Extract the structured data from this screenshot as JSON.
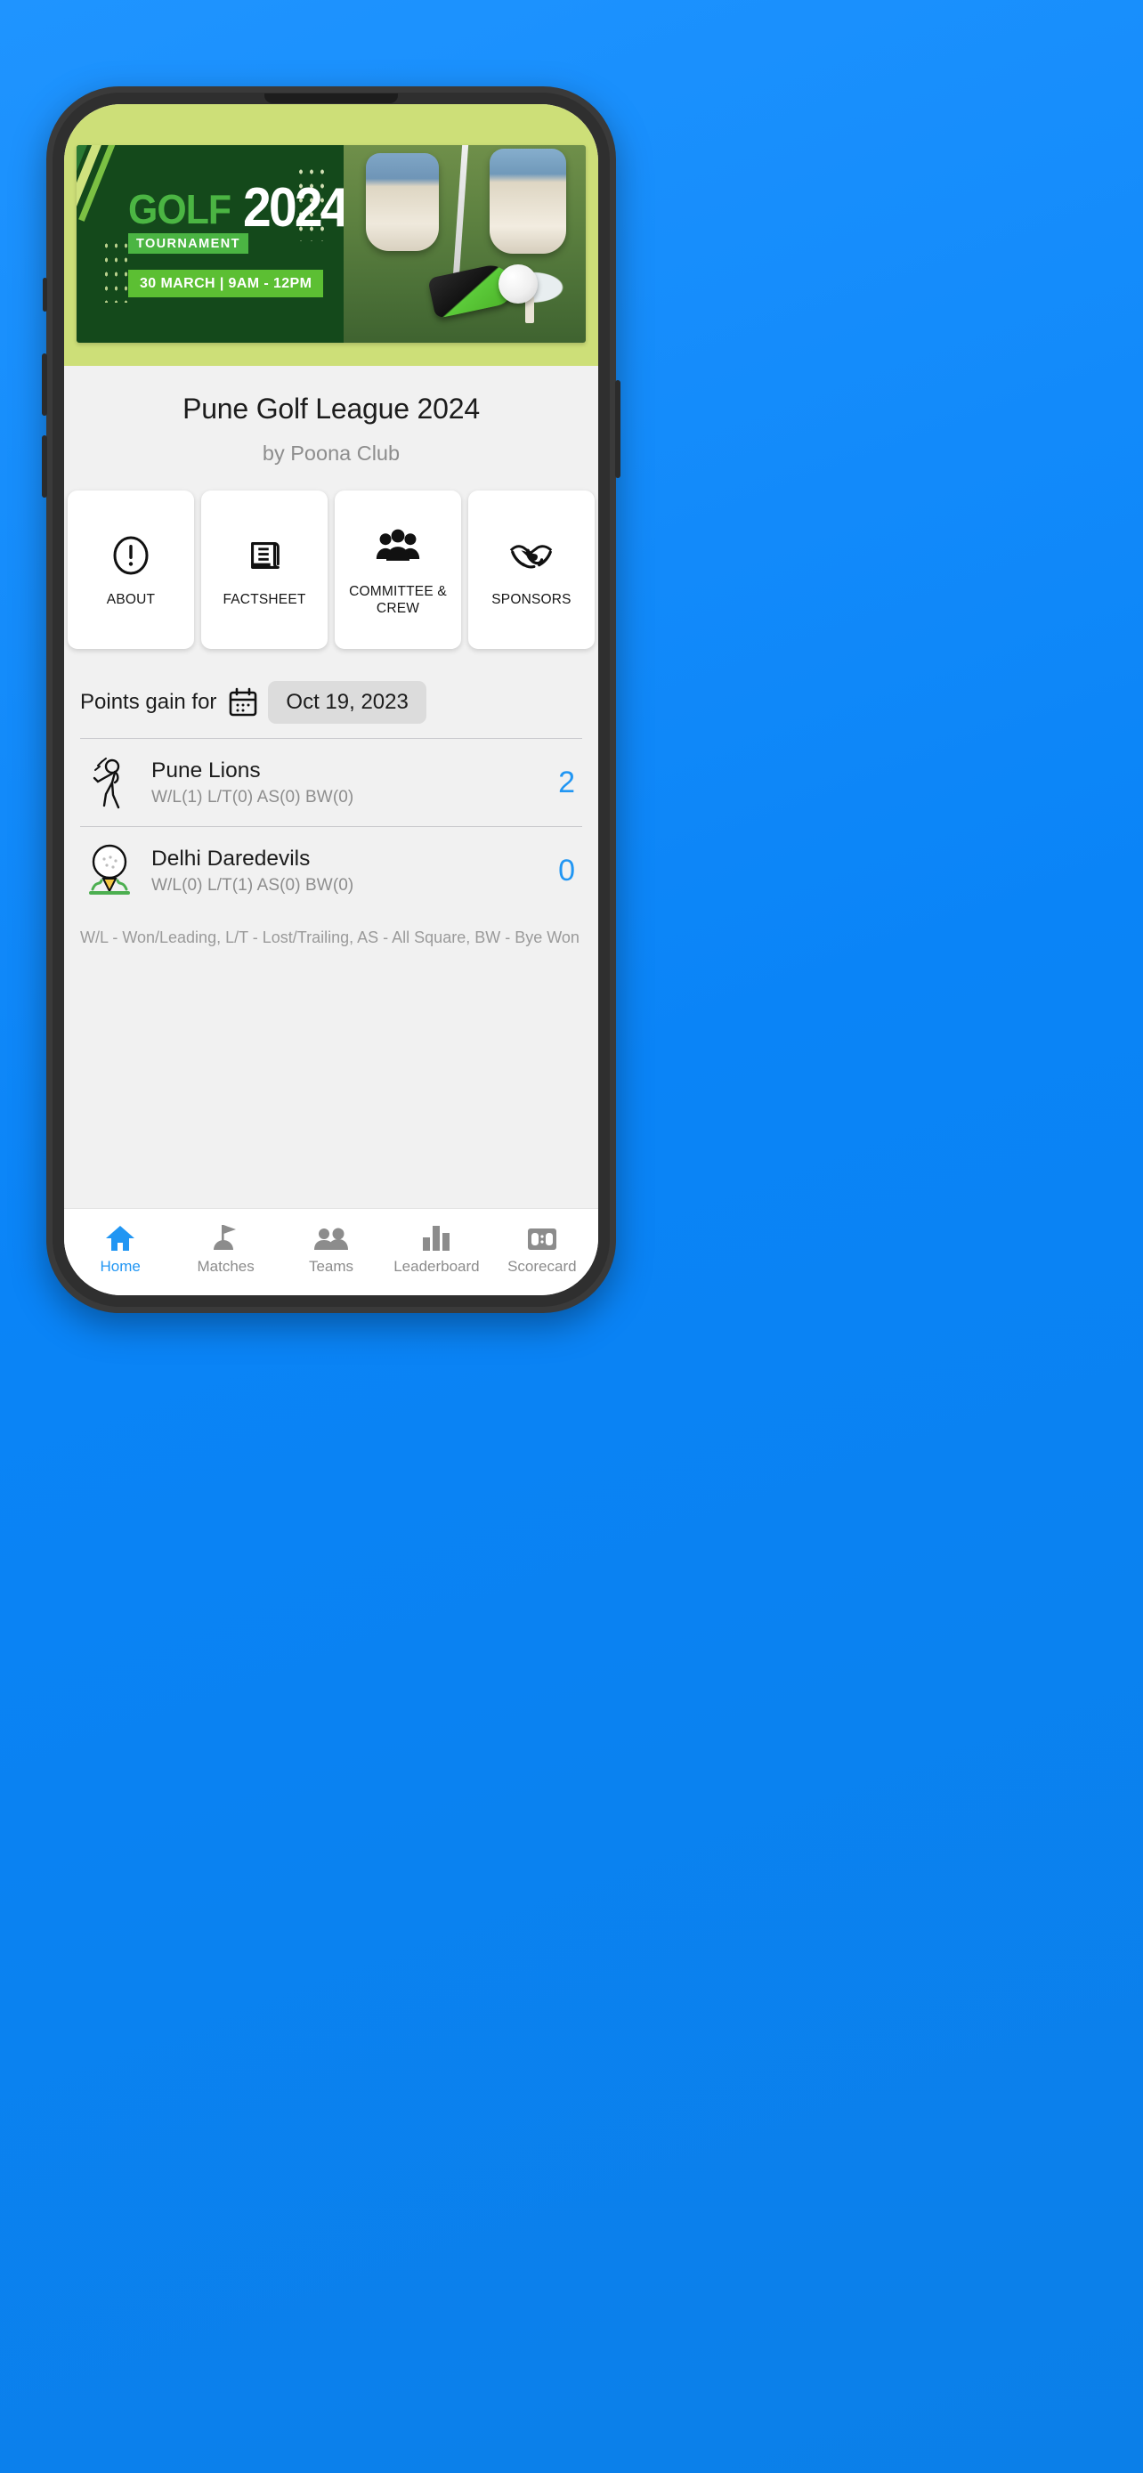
{
  "banner": {
    "golf_text": "GOLF",
    "year_text": "2024",
    "tournament_text": "TOURNAMENT",
    "date_text": "30 MARCH | 9AM - 12PM",
    "bg_color": "#cddf78",
    "dark_green": "#14491b",
    "accent_green": "#4bb543"
  },
  "header": {
    "title": "Pune Golf League 2024",
    "subtitle": "by Poona Club"
  },
  "cards": [
    {
      "label": "ABOUT",
      "icon": "info-circle-icon"
    },
    {
      "label": "FACTSHEET",
      "icon": "scroll-document-icon"
    },
    {
      "label": "COMMITTEE & CREW",
      "icon": "people-group-icon"
    },
    {
      "label": "SPONSORS",
      "icon": "handshake-icon"
    }
  ],
  "points": {
    "label": "Points gain for",
    "calendar_icon": "calendar-icon",
    "date": "Oct 19, 2023",
    "teams": [
      {
        "name": "Pune Lions",
        "stats": "W/L(1)  L/T(0)  AS(0)  BW(0)",
        "points": "2",
        "avatar": "golfer-swing-icon"
      },
      {
        "name": "Delhi Daredevils",
        "stats": "W/L(0)  L/T(1)  AS(0)  BW(0)",
        "points": "0",
        "avatar": "golf-ball-tee-icon"
      }
    ],
    "legend": "W/L - Won/Leading, L/T - Lost/Trailing, AS - All Square, BW - Bye Won",
    "points_color": "#2196f3"
  },
  "bottom_nav": {
    "active_color": "#2196f3",
    "inactive_color": "#8c8c8c",
    "items": [
      {
        "label": "Home",
        "icon": "home-icon",
        "active": true
      },
      {
        "label": "Matches",
        "icon": "golf-flag-icon",
        "active": false
      },
      {
        "label": "Teams",
        "icon": "people-icon",
        "active": false
      },
      {
        "label": "Leaderboard",
        "icon": "bar-chart-icon",
        "active": false
      },
      {
        "label": "Scorecard",
        "icon": "scorecard-icon",
        "active": false
      }
    ]
  }
}
